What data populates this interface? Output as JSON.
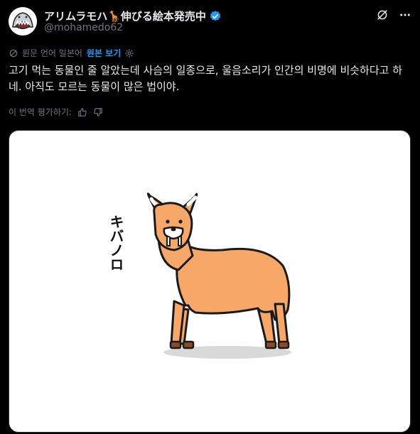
{
  "author": {
    "display_name": "アリムラモハ🦒伸びる絵本発売中",
    "handle": "@mohamedo62"
  },
  "translation": {
    "notice": "원문 언어 일본어",
    "show_original": "원본 보기"
  },
  "post": {
    "text": "고기 먹는 동물인 줄 알았는데 사슴의 일종으로, 울음소리가 인간의 비명에 비슷하다고 하네. 아직도 모르는 동물이 많은 법이야."
  },
  "rate": {
    "label": "이 번역 평가하기:"
  },
  "media": {
    "caption": "キバノロ"
  },
  "colors": {
    "background": "#000000",
    "accent": "#1d9bf0",
    "verified": "#1d9bf0",
    "animal_fill": "#F7A868",
    "outline": "#1a1a1a"
  },
  "icons": {
    "verified": "verified-badge-icon",
    "grok": "grok-icon",
    "more": "more-icon",
    "translate": "translate-icon",
    "settings": "settings-icon",
    "thumbs_up": "thumbs-up-icon",
    "thumbs_down": "thumbs-down-icon"
  }
}
